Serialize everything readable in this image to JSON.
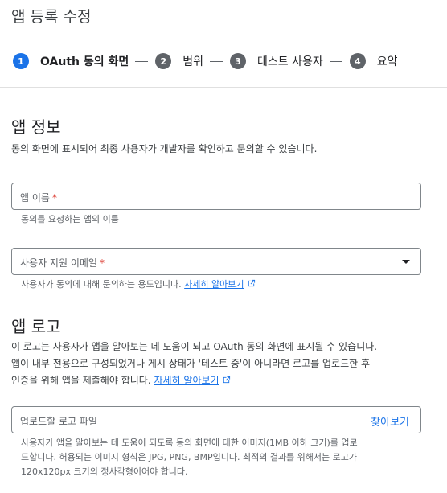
{
  "header": {
    "title": "앱 등록 수정"
  },
  "steps": [
    {
      "number": "1",
      "label": "OAuth 동의 화면"
    },
    {
      "number": "2",
      "label": "범위"
    },
    {
      "number": "3",
      "label": "테스트 사용자"
    },
    {
      "number": "4",
      "label": "요약"
    }
  ],
  "app_info": {
    "title": "앱 정보",
    "description": "동의 화면에 표시되어 최종 사용자가 개발자를 확인하고 문의할 수 있습니다.",
    "app_name": {
      "label": "앱 이름",
      "required": "*",
      "helper": "동의를 요청하는 앱의 이름"
    },
    "support_email": {
      "label": "사용자 지원 이메일",
      "required": "*",
      "helper": "사용자가 동의에 대해 문의하는 용도입니다.",
      "link": "자세히 알아보기"
    }
  },
  "app_logo": {
    "title": "앱 로고",
    "desc_line1": "이 로고는 사용자가 앱을 알아보는 데 도움이 되고 OAuth 동의 화면에 표시될 수 있습니다.",
    "desc_line2": "앱이 내부 전용으로 구성되었거나 게시 상태가 '테스트 중'이 아니라면 로고를 업로드한 후",
    "desc_line3": "인증을 위해 앱을 제출해야 합니다.",
    "link": "자세히 알아보기",
    "upload_label": "업로드할 로고 파일",
    "browse": "찾아보기",
    "helper_line1": "사용자가 앱을 알아보는 데 도움이 되도록 동의 화면에 대한 이미지(1MB 이하 크기)를 업로",
    "helper_line2": "드합니다. 허용되는 이미지 형식은 JPG, PNG, BMP입니다. 최적의 결과를 위해서는 로고가",
    "helper_line3": "120x120px 크기의 정사각형이어야 합니다."
  },
  "colors": {
    "accent": "#1a73e8",
    "required": "#d93025",
    "inactive_step": "#5f6368"
  }
}
